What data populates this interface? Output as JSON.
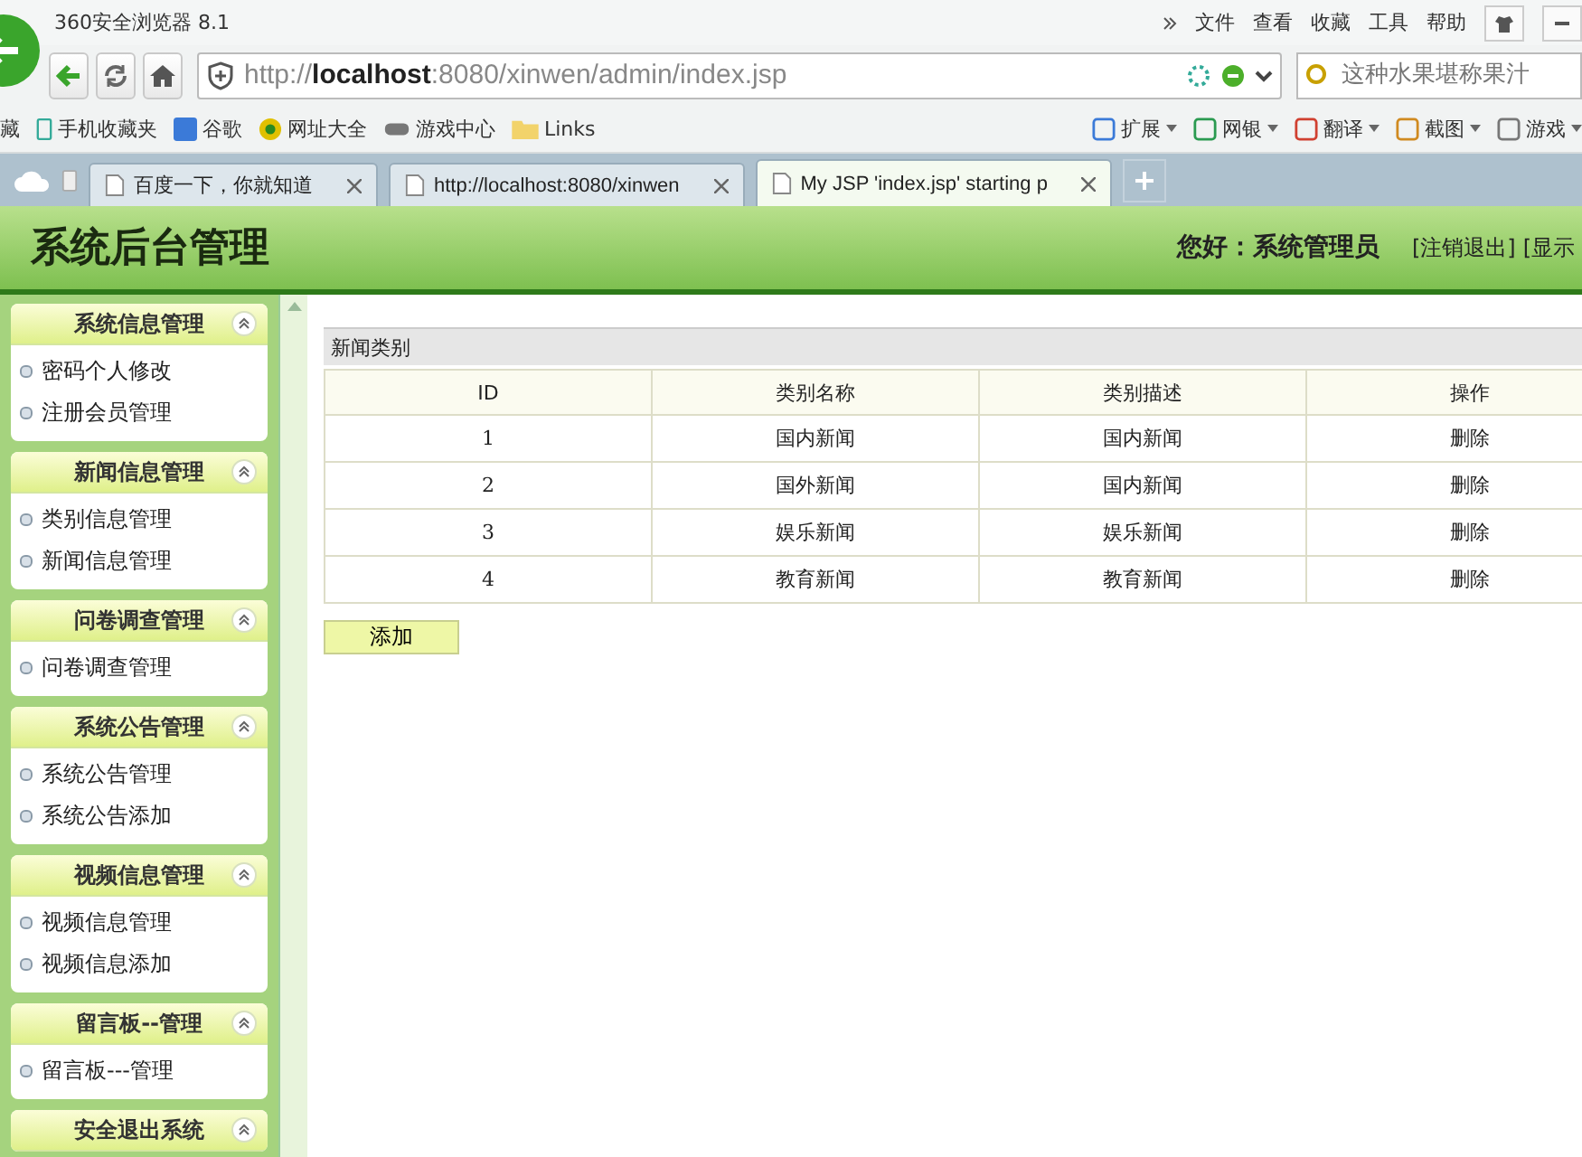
{
  "browser": {
    "title": "360安全浏览器 8.1",
    "menu": [
      "文件",
      "查看",
      "收藏",
      "工具",
      "帮助"
    ],
    "address": {
      "prefix": "http://",
      "host": "localhost",
      "rest": ":8080/xinwen/admin/index.jsp"
    },
    "search": {
      "placeholder": "这种水果堪称果汁"
    },
    "bookmarks": [
      "藏",
      "手机收藏夹",
      "谷歌",
      "网址大全",
      "游戏中心",
      "Links"
    ],
    "tools": [
      "扩展",
      "网银",
      "翻译",
      "截图",
      "游戏"
    ],
    "tabs": [
      {
        "label": "百度一下，你就知道",
        "selected": false
      },
      {
        "label": "http://localhost:8080/xinwen",
        "selected": false
      },
      {
        "label": "My JSP 'index.jsp' starting p",
        "selected": true
      }
    ]
  },
  "header": {
    "title": "系统后台管理",
    "greeting": "您好：系统管理员",
    "links": [
      "[注销退出]",
      "[显示"
    ]
  },
  "sidebar": [
    {
      "title": "系统信息管理",
      "expanded": true,
      "items": [
        "密码个人修改",
        "注册会员管理"
      ]
    },
    {
      "title": "新闻信息管理",
      "expanded": true,
      "items": [
        "类别信息管理",
        "新闻信息管理"
      ]
    },
    {
      "title": "问卷调查管理",
      "expanded": true,
      "items": [
        "问卷调查管理"
      ]
    },
    {
      "title": "系统公告管理",
      "expanded": true,
      "items": [
        "系统公告管理",
        "系统公告添加"
      ]
    },
    {
      "title": "视频信息管理",
      "expanded": true,
      "items": [
        "视频信息管理",
        "视频信息添加"
      ]
    },
    {
      "title": "留言板--管理",
      "expanded": true,
      "items": [
        "留言板---管理"
      ]
    },
    {
      "title": "安全退出系统",
      "expanded": true
    }
  ],
  "content": {
    "title": "新闻类别",
    "table": {
      "columns": [
        "ID",
        "类别名称",
        "类别描述",
        "操作"
      ],
      "rows": [
        [
          "1",
          "国内新闻",
          "国内新闻",
          "删除"
        ],
        [
          "2",
          "国外新闻",
          "国内新闻",
          "删除"
        ],
        [
          "3",
          "娱乐新闻",
          "娱乐新闻",
          "删除"
        ],
        [
          "4",
          "教育新闻",
          "教育新闻",
          "删除"
        ]
      ]
    },
    "add_button": "添加"
  }
}
